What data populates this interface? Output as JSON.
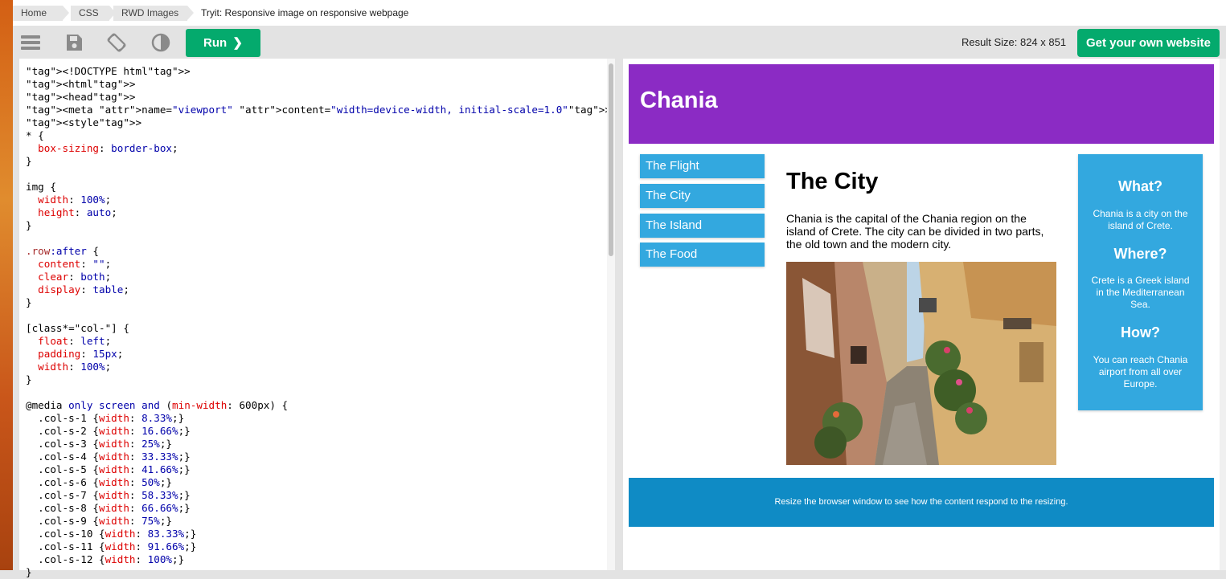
{
  "breadcrumbs": [
    "Home",
    "CSS",
    "RWD Images"
  ],
  "page_title": "Tryit: Responsive image on responsive webpage",
  "toolbar": {
    "menu_icon": "hamburger-menu-icon",
    "save_icon": "save-icon",
    "rotate_icon": "rotate-screen-icon",
    "theme_icon": "contrast-icon",
    "run_label": "Run",
    "result_size": "Result Size: 824 x 851",
    "get_website_label": "Get your own website"
  },
  "code_lines": [
    "<!DOCTYPE html>",
    "<html>",
    "<head>",
    "<meta name=\"viewport\" content=\"width=device-width, initial-scale=1.0\">",
    "<style>",
    "* {",
    "  box-sizing: border-box;",
    "}",
    "",
    "img {",
    "  width: 100%;",
    "  height: auto;",
    "}",
    "",
    ".row:after {",
    "  content: \"\";",
    "  clear: both;",
    "  display: table;",
    "}",
    "",
    "[class*=\"col-\"] {",
    "  float: left;",
    "  padding: 15px;",
    "  width: 100%;",
    "}",
    "",
    "@media only screen and (min-width: 600px) {",
    "  .col-s-1 {width: 8.33%;}",
    "  .col-s-2 {width: 16.66%;}",
    "  .col-s-3 {width: 25%;}",
    "  .col-s-4 {width: 33.33%;}",
    "  .col-s-5 {width: 41.66%;}",
    "  .col-s-6 {width: 50%;}",
    "  .col-s-7 {width: 58.33%;}",
    "  .col-s-8 {width: 66.66%;}",
    "  .col-s-9 {width: 75%;}",
    "  .col-s-10 {width: 83.33%;}",
    "  .col-s-11 {width: 91.66%;}",
    "  .col-s-12 {width: 100%;}",
    "}"
  ],
  "result": {
    "header_title": "Chania",
    "menu": [
      "The Flight",
      "The City",
      "The Island",
      "The Food"
    ],
    "main_heading": "The City",
    "main_text": "Chania is the capital of the Chania region on the island of Crete. The city can be divided in two parts, the old town and the modern city.",
    "aside": {
      "h1": "What?",
      "t1": "Chania is a city on the island of Crete.",
      "h2": "Where?",
      "t2": "Crete is a Greek island in the Mediterranean Sea.",
      "h3": "How?",
      "t3": "You can reach Chania airport from all over Europe."
    },
    "footer_text": "Resize the browser window to see how the content respond to the resizing."
  },
  "colors": {
    "run_green": "#04aa6d",
    "header_purple": "#8b2bc4",
    "menu_blue": "#33a8df",
    "footer_blue": "#0f8bc5"
  }
}
